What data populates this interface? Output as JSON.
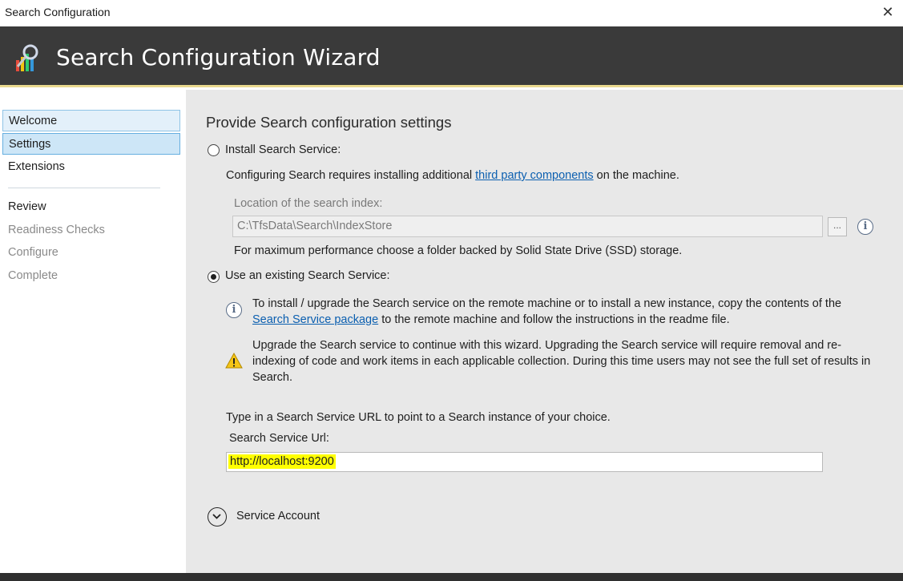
{
  "window": {
    "title": "Search Configuration",
    "close_glyph": "✕"
  },
  "header": {
    "title": "Search Configuration Wizard",
    "logo_icon": "search-wizard-icon"
  },
  "sidebar": {
    "items": [
      {
        "label": "Welcome",
        "state": "visited"
      },
      {
        "label": "Settings",
        "state": "selected"
      },
      {
        "label": "Extensions",
        "state": "normal"
      },
      {
        "label": "Review",
        "state": "normal"
      },
      {
        "label": "Readiness Checks",
        "state": "disabled"
      },
      {
        "label": "Configure",
        "state": "disabled"
      },
      {
        "label": "Complete",
        "state": "disabled"
      }
    ]
  },
  "main": {
    "heading": "Provide Search configuration settings",
    "install_option": {
      "label": "Install Search Service:",
      "checked": false,
      "desc_prefix": "Configuring Search requires installing additional ",
      "desc_link": "third party components",
      "desc_suffix": " on the machine.",
      "location_label": "Location of the search index:",
      "location_value": "C:\\TfsData\\Search\\IndexStore",
      "browse_label": "...",
      "perf_note": "For maximum performance choose a folder backed by Solid State Drive (SSD) storage."
    },
    "existing_option": {
      "label": "Use an existing Search Service:",
      "checked": true,
      "info_prefix": "To install / upgrade the Search service on the remote machine or to install a new instance, copy the contents of the ",
      "info_link": "Search Service package",
      "info_suffix": " to the remote machine and follow the instructions in the readme file.",
      "warning_text": "Upgrade the Search service to continue with this wizard. Upgrading the Search service will require removal and re-indexing of code and work items in each applicable collection. During this time users may not see the full set of results in Search.",
      "url_prompt": "Type in a Search Service URL to point to a Search instance of your choice.",
      "url_label": "Search Service Url:",
      "url_value": "http://localhost:9200"
    },
    "service_account": {
      "label": "Service Account"
    }
  },
  "colors": {
    "header_bg": "#3a3a3a",
    "header_accent": "#e9d98e",
    "selected_nav_bg": "#cde6f7",
    "link": "#0b5fb0",
    "highlight": "#ffff00"
  }
}
